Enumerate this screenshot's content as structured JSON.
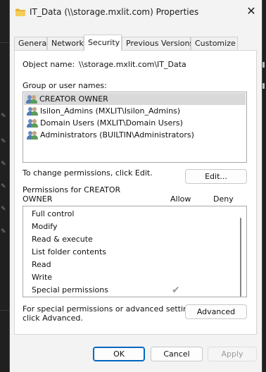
{
  "window": {
    "title": "IT_Data (\\\\storage.mxlit.com) Properties",
    "close_glyph": "✕"
  },
  "tabs": [
    {
      "label": "General"
    },
    {
      "label": "Network"
    },
    {
      "label": "Security"
    },
    {
      "label": "Previous Versions"
    },
    {
      "label": "Customize"
    }
  ],
  "security": {
    "object_name_label": "Object name:",
    "object_name_value": "\\\\storage.mxlit.com\\IT_Data",
    "groups_label": "Group or user names:",
    "groups": [
      {
        "name": "CREATOR OWNER",
        "selected": true
      },
      {
        "name": "Isilon_Admins (MXLIT\\Isilon_Admins)",
        "selected": false
      },
      {
        "name": "Domain Users (MXLIT\\Domain Users)",
        "selected": false
      },
      {
        "name": "Administrators (BUILTIN\\Administrators)",
        "selected": false
      }
    ],
    "change_text": "To change permissions, click Edit.",
    "edit_label": "Edit...",
    "perm_header_line1": "Permissions for CREATOR",
    "perm_header_line2": "OWNER",
    "allow_label": "Allow",
    "deny_label": "Deny",
    "permissions": [
      {
        "name": "Full control",
        "allow": false,
        "deny": false
      },
      {
        "name": "Modify",
        "allow": false,
        "deny": false
      },
      {
        "name": "Read & execute",
        "allow": false,
        "deny": false
      },
      {
        "name": "List folder contents",
        "allow": false,
        "deny": false
      },
      {
        "name": "Read",
        "allow": false,
        "deny": false
      },
      {
        "name": "Write",
        "allow": false,
        "deny": false
      },
      {
        "name": "Special permissions",
        "allow": true,
        "deny": false
      }
    ],
    "check_glyph": "✔",
    "advanced_text_line1": "For special permissions or advanced settings,",
    "advanced_text_line2": "click Advanced.",
    "advanced_label": "Advanced"
  },
  "footer": {
    "ok_label": "OK",
    "cancel_label": "Cancel",
    "apply_label": "Apply"
  },
  "colors": {
    "accent": "#0067c0",
    "selection": "#d9d9d9",
    "folder": "#f2c14e"
  }
}
